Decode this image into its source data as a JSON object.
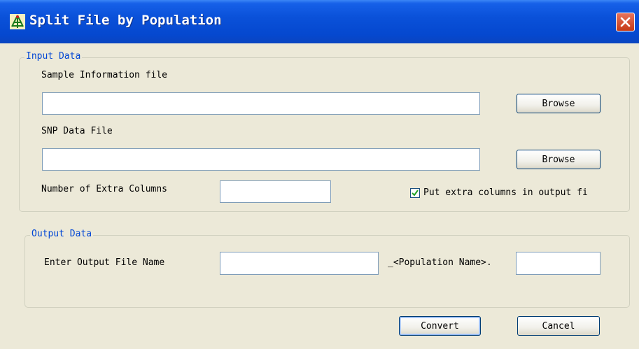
{
  "window": {
    "title": "Split File by Population",
    "icon": "population-tree-icon",
    "close_icon": "close-icon"
  },
  "input_group": {
    "legend": "Input Data",
    "sample_info_label": "Sample Information file",
    "sample_info_value": "",
    "snp_label": "SNP Data File",
    "snp_value": "",
    "browse_label": "Browse",
    "extra_cols_label": "Number of Extra Columns",
    "extra_cols_value": "",
    "put_extra_label": "Put extra columns in output fi",
    "put_extra_checked": true
  },
  "output_group": {
    "legend": "Output Data",
    "file_name_label": "Enter Output File Name",
    "file_name_value": "",
    "suffix_text": "_<Population Name>.",
    "extension_value": ""
  },
  "buttons": {
    "convert": "Convert",
    "cancel": "Cancel"
  },
  "colors": {
    "title_bar": "#0a51d9",
    "legend": "#0046d5",
    "dialog_bg": "#ece9d8"
  }
}
